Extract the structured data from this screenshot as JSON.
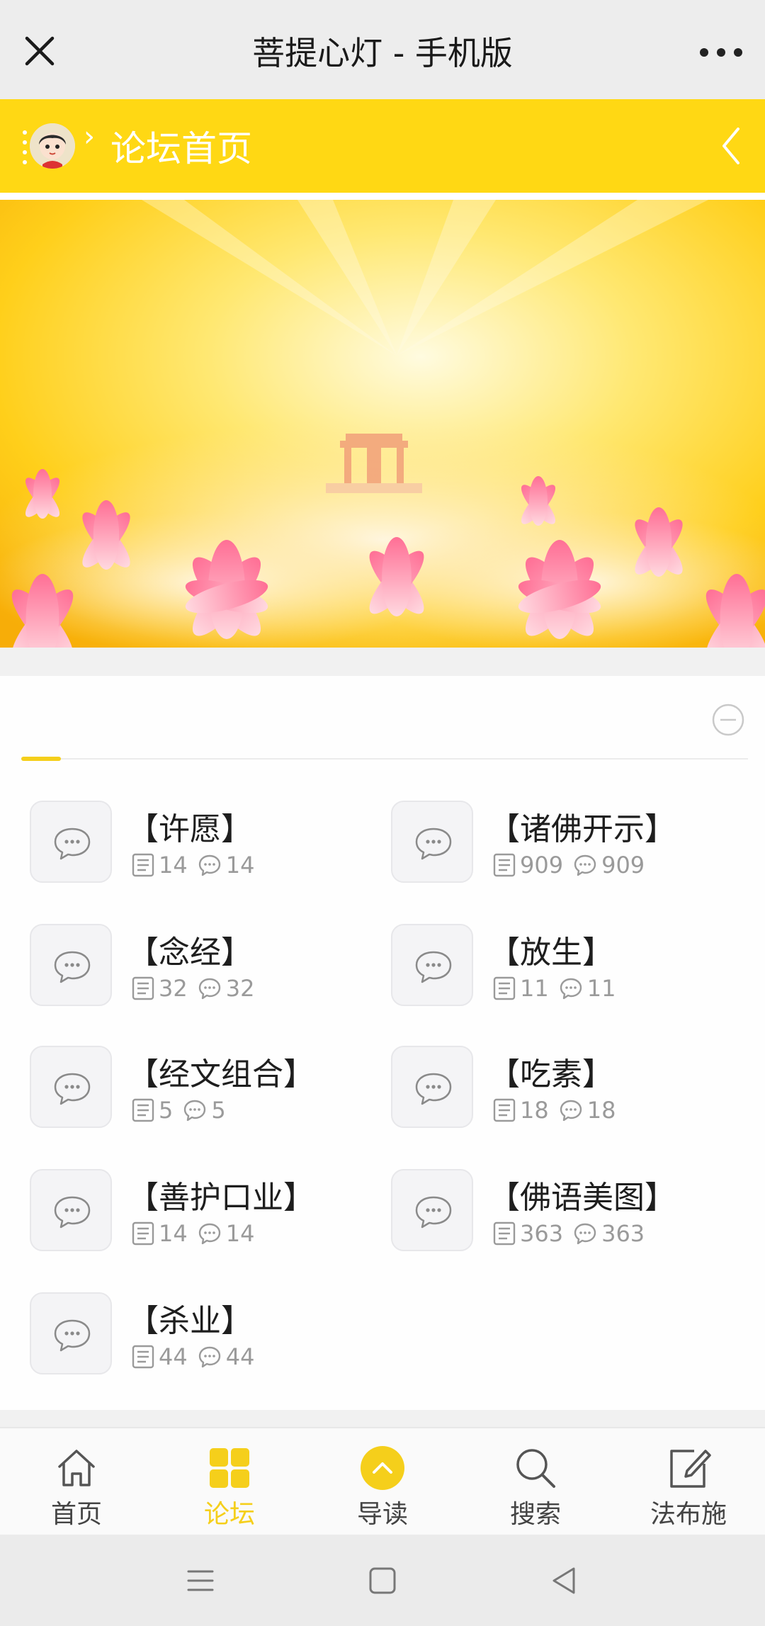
{
  "topbar": {
    "title": "菩提心灯 - 手机版"
  },
  "forum_header": {
    "title": "论坛首页"
  },
  "forums": [
    {
      "name": "【许愿】",
      "threads": "14",
      "posts": "14"
    },
    {
      "name": "【诸佛开示】",
      "threads": "909",
      "posts": "909"
    },
    {
      "name": "【念经】",
      "threads": "32",
      "posts": "32"
    },
    {
      "name": "【放生】",
      "threads": "11",
      "posts": "11"
    },
    {
      "name": "【经文组合】",
      "threads": "5",
      "posts": "5"
    },
    {
      "name": "【吃素】",
      "threads": "18",
      "posts": "18"
    },
    {
      "name": "【善护口业】",
      "threads": "14",
      "posts": "14"
    },
    {
      "name": "【佛语美图】",
      "threads": "363",
      "posts": "363"
    },
    {
      "name": "【杀业】",
      "threads": "44",
      "posts": "44"
    }
  ],
  "bottom_nav": [
    {
      "label": "首页",
      "icon": "home-icon"
    },
    {
      "label": "论坛",
      "icon": "grid-icon",
      "active": true
    },
    {
      "label": "导读",
      "icon": "chevron-up-circle-icon"
    },
    {
      "label": "搜索",
      "icon": "search-icon"
    },
    {
      "label": "法布施",
      "icon": "edit-icon"
    }
  ],
  "colors": {
    "accent": "#ffd814",
    "active": "#f5cf1b"
  }
}
